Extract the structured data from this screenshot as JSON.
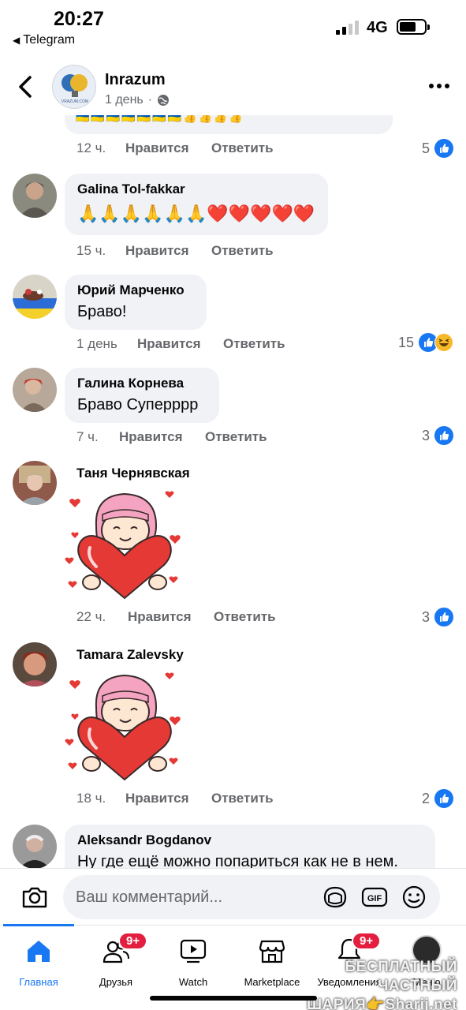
{
  "status_bar": {
    "time": "20:27",
    "back_app": "Telegram",
    "network": "4G"
  },
  "header": {
    "page_name": "Inrazum",
    "time_ago": "1 день",
    "more_label": "•••"
  },
  "partial_comment": {
    "text": "🇺🇦🇺🇦🇺🇦🇺🇦🇺🇦🇺🇦🇺🇦👍👍👍👍"
  },
  "comments": [
    {
      "author": "",
      "text": "",
      "time": "12 ч.",
      "like_label": "Нравится",
      "reply_label": "Ответить",
      "reactions": "5"
    },
    {
      "author": "Galina Tol-fakkar",
      "text": "🙏🙏🙏🙏🙏🙏❤️❤️❤️❤️❤️",
      "time": "15 ч.",
      "like_label": "Нравится",
      "reply_label": "Ответить",
      "reactions": ""
    },
    {
      "author": "Юрий Марченко",
      "text": "Браво!",
      "time": "1 день",
      "like_label": "Нравится",
      "reply_label": "Ответить",
      "reactions": "15"
    },
    {
      "author": "Галина Корнева",
      "text": "Браво Суперррр",
      "time": "7 ч.",
      "like_label": "Нравится",
      "reply_label": "Ответить",
      "reactions": "3"
    },
    {
      "author": "Таня Чернявская",
      "text": "",
      "time": "22 ч.",
      "like_label": "Нравится",
      "reply_label": "Ответить",
      "reactions": "3"
    },
    {
      "author": "Tamara Zalevsky",
      "text": "",
      "time": "18 ч.",
      "like_label": "Нравится",
      "reply_label": "Ответить",
      "reactions": "2"
    },
    {
      "author": "Aleksandr Bogdanov",
      "text": "Ну где ещё можно попариться как не в нем."
    }
  ],
  "composer": {
    "placeholder": "Ваш комментарий..."
  },
  "tabs": [
    {
      "label": "Главная"
    },
    {
      "label": "Друзья",
      "badge": "9+"
    },
    {
      "label": "Watch"
    },
    {
      "label": "Marketplace"
    },
    {
      "label": "Уведомления",
      "badge": "9+"
    },
    {
      "label": "Меню"
    }
  ],
  "watermark": {
    "line1": "БЕСПЛАТНЫЙ ЧАСТНЫЙ",
    "line2": "ШАРИЯ👉Sharij.net"
  },
  "colors": {
    "accent": "#1877f2",
    "bubble": "#f0f2f5",
    "badge": "#e41e3f",
    "muted": "#65676b"
  }
}
